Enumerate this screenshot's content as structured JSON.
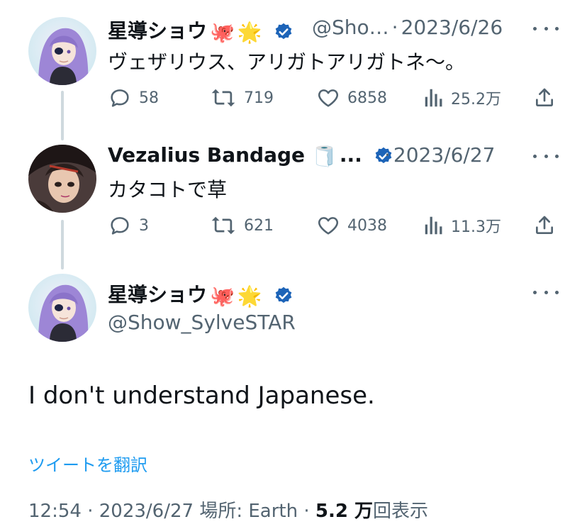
{
  "tweets": [
    {
      "name": "星導ショウ",
      "emoji1": "🐙",
      "emoji2": "🌟",
      "handle": "@Sho…",
      "sep": "·",
      "date": "2023/6/26",
      "text": "ヴェザリウス、アリガトアリガトネ〜。",
      "replies": "58",
      "retweets": "719",
      "likes": "6858",
      "views": "25.2万"
    },
    {
      "name": "Vezalius Bandage",
      "emoji1": "🧻",
      "ellipsis": "...",
      "sep": "·",
      "date": "2023/6/27",
      "text": "カタコトで草",
      "replies": "3",
      "retweets": "621",
      "likes": "4038",
      "views": "11.3万"
    }
  ],
  "main": {
    "name": "星導ショウ",
    "emoji1": "🐙",
    "emoji2": "🌟",
    "handle": "@Show_SylveSTAR",
    "text": "I don't understand Japanese.",
    "translate": "ツイートを翻訳",
    "time": "12:54",
    "date": "2023/6/27",
    "location": "場所: Earth",
    "views_count": "5.2 万",
    "views_label": "回表示",
    "sep": "·"
  },
  "icons": {
    "verified": "verified-badge-icon",
    "reply": "reply-icon",
    "retweet": "retweet-icon",
    "like": "heart-icon",
    "views": "views-icon",
    "share": "share-icon",
    "more": "more-icon"
  },
  "colors": {
    "verified": "#1d64b8",
    "link": "#1d9bf0",
    "secondary": "#536471",
    "primary": "#0f1419"
  }
}
